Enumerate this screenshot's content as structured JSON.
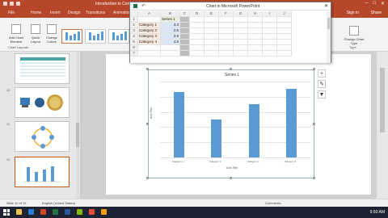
{
  "powerpoint": {
    "title": "Introduction to Com...",
    "window_controls": [
      "–",
      "□",
      "✕"
    ],
    "tabs": [
      "File",
      "Home",
      "Insert",
      "Design",
      "Transitions",
      "Animations"
    ],
    "sign_in": "Sign in",
    "share": "Share"
  },
  "ribbon": {
    "add_chart_element": "Add Chart Element",
    "quick_layout": "Quick Layout",
    "change_colors": "Change Colors",
    "chart_layouts_group": "Chart Layouts",
    "change_chart_type": "Change Chart Type",
    "type_group": "Type"
  },
  "thumbnails": [
    {
      "num": "",
      "active": false
    },
    {
      "num": "10",
      "active": false
    },
    {
      "num": "11",
      "active": false
    },
    {
      "num": "12",
      "active": true
    }
  ],
  "data_sheet": {
    "title": "Chart in Microsoft PowerPoint",
    "columns": [
      "",
      "A",
      "B",
      "C",
      "D",
      "E",
      "F",
      "G",
      "H",
      "I",
      "J"
    ],
    "rows": [
      {
        "num": "1",
        "a": "",
        "b": "Series 1"
      },
      {
        "num": "2",
        "a": "Category 1",
        "b": "4.3"
      },
      {
        "num": "3",
        "a": "Category 2",
        "b": "2.5"
      },
      {
        "num": "4",
        "a": "Category 3",
        "b": "3.5"
      },
      {
        "num": "5",
        "a": "Category 4",
        "b": "4.5"
      },
      {
        "num": "6",
        "a": "",
        "b": ""
      },
      {
        "num": "7",
        "a": "",
        "b": ""
      }
    ]
  },
  "chart_data": {
    "type": "bar",
    "title": "Series 1",
    "categories": [
      "Category 1",
      "Category 2",
      "Category 3",
      "Category 4"
    ],
    "series": [
      {
        "name": "Series 1",
        "values": [
          4.3,
          2.5,
          3.5,
          4.5
        ]
      }
    ],
    "xlabel": "Axis Title",
    "ylabel": "Axis Title",
    "ylim": [
      0,
      5
    ],
    "grid": true,
    "bar_color": "#5b9bd5"
  },
  "status_bar": {
    "slide_info": "Slide 12 of 12",
    "language": "English (United States)",
    "comments": "Comments"
  },
  "taskbar": {
    "time": "9:50 AM"
  },
  "colors": {
    "accent": "#b7472a",
    "bar": "#5b9bd5"
  }
}
